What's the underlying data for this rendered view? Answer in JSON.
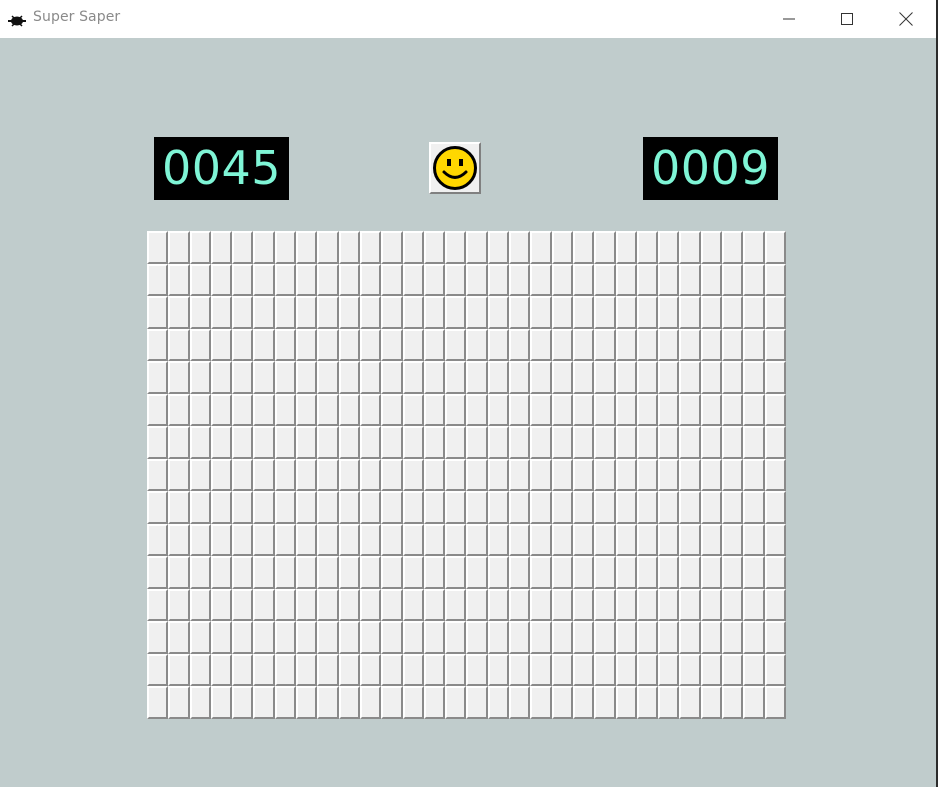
{
  "window": {
    "title": "Super Saper",
    "background": "#c0cccc"
  },
  "title_bar_buttons": {
    "minimize_icon": "minimize-icon",
    "maximize_icon": "maximize-icon",
    "close_icon": "close-icon"
  },
  "counters": {
    "mines": "0045",
    "timer": "0009",
    "digit_color": "#7ff5d6",
    "background": "#000000"
  },
  "face": {
    "icon": "smiley-face-icon",
    "state": "smile",
    "color": "#ffd700"
  },
  "board": {
    "columns": 30,
    "rows": 15,
    "cell_state": "unrevealed",
    "cell_color": "#f0f0f0"
  }
}
